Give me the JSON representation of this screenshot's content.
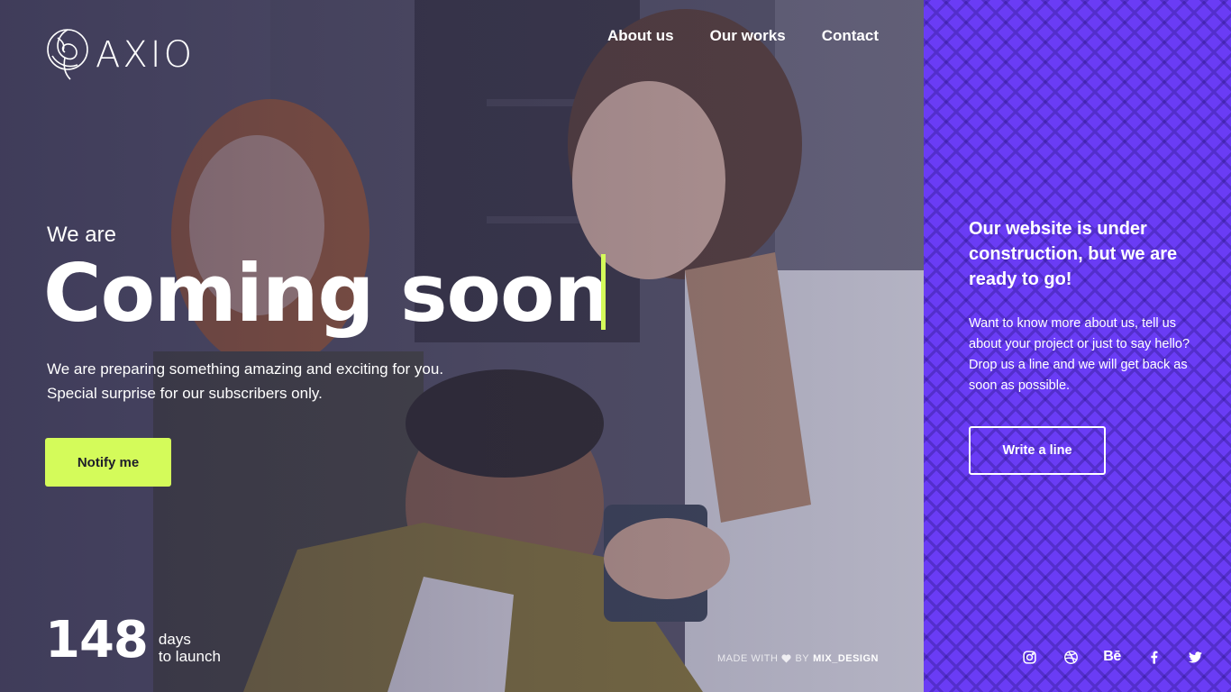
{
  "brand": {
    "name": "AXIO"
  },
  "nav": {
    "items": [
      {
        "label": "About us"
      },
      {
        "label": "Our works"
      },
      {
        "label": "Contact"
      }
    ]
  },
  "hero": {
    "pre_title": "We are",
    "title": "Coming soon",
    "lead_line1": "We are preparing something amazing and exciting for you.",
    "lead_line2": "Special surprise for our subscribers only.",
    "notify_label": "Notify me"
  },
  "countdown": {
    "value": "148",
    "unit": "days",
    "caption": "to launch"
  },
  "credit": {
    "prefix": "MADE WITH",
    "middle": "BY",
    "author": "MIX_DESIGN"
  },
  "panel": {
    "title": "Our website is under construction, but we are ready to go!",
    "text": "Want to know more about us, tell us about your project or just to say hello? Drop us a line and we will get back as soon as possible.",
    "button_label": "Write a line"
  },
  "socials": [
    {
      "icon": "instagram-icon"
    },
    {
      "icon": "dribbble-icon"
    },
    {
      "icon": "behance-icon",
      "glyph": "Bē"
    },
    {
      "icon": "facebook-icon"
    },
    {
      "icon": "twitter-icon"
    }
  ],
  "colors": {
    "accent": "#d4fb5a",
    "panel": "#6a3cf5",
    "overlay": "#2b2848"
  }
}
